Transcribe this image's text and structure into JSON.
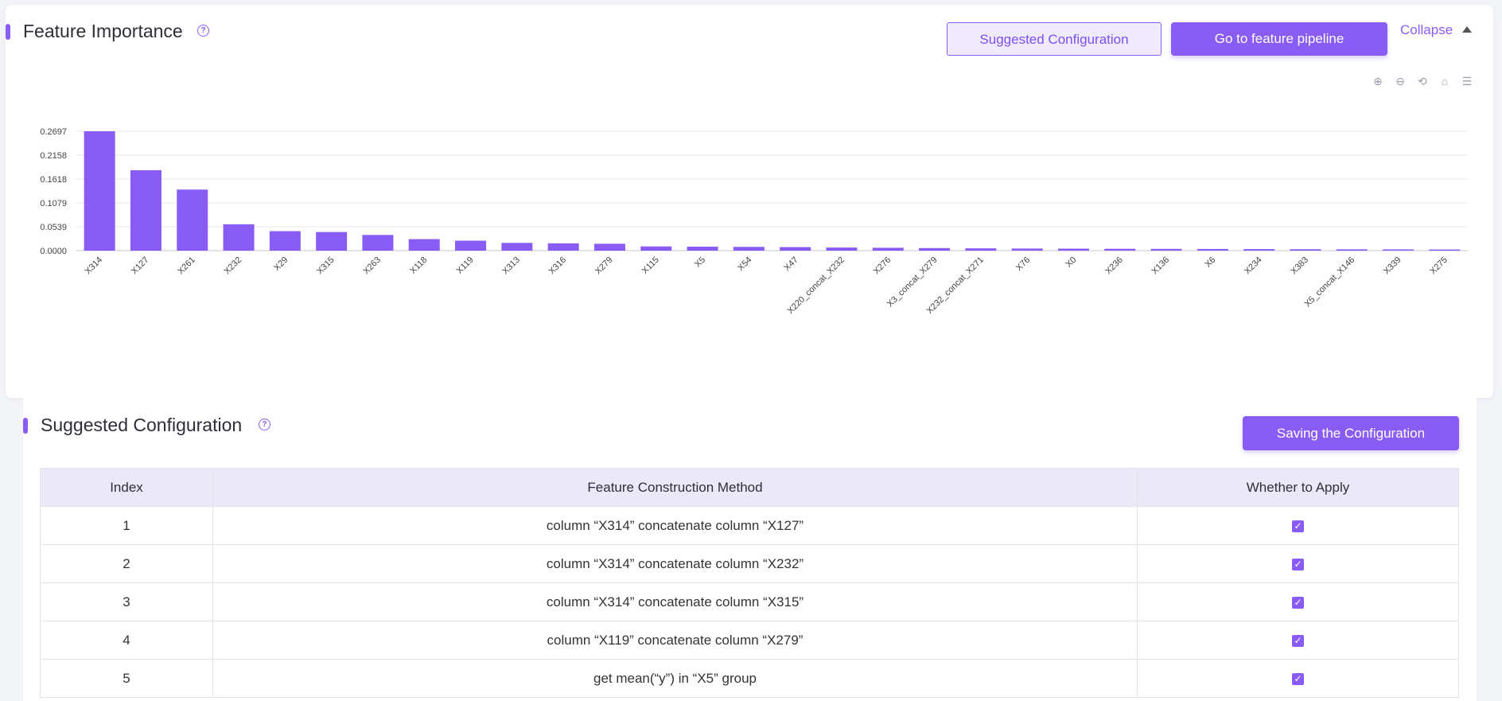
{
  "feature_importance": {
    "title": "Feature Importance",
    "help_icon": "question-circle-icon",
    "suggested_config_button": "Suggested Configuration",
    "pipeline_button": "Go to feature pipeline",
    "collapse_label": "Collapse",
    "toolbox_icons": [
      "zoom-in-icon",
      "zoom-out-icon",
      "restore-icon",
      "home-icon",
      "menu-icon"
    ]
  },
  "chart_data": {
    "type": "bar",
    "categories": [
      "X314",
      "X127",
      "X261",
      "X232",
      "X29",
      "X315",
      "X263",
      "X118",
      "X119",
      "X313",
      "X316",
      "X279",
      "X115",
      "X5",
      "X54",
      "X47",
      "X220_concat_X232",
      "X276",
      "X3_concat_X279",
      "X232_concat_X271",
      "X76",
      "X0",
      "X236",
      "X136",
      "X6",
      "X234",
      "X383",
      "X5_concat_X146",
      "X339",
      "X275"
    ],
    "values": [
      0.2697,
      0.1818,
      0.138,
      0.0595,
      0.044,
      0.042,
      0.0355,
      0.026,
      0.0225,
      0.0175,
      0.0165,
      0.0155,
      0.0095,
      0.009,
      0.0085,
      0.008,
      0.007,
      0.0065,
      0.0058,
      0.0052,
      0.0048,
      0.0045,
      0.0042,
      0.004,
      0.0038,
      0.0035,
      0.0032,
      0.003,
      0.0028,
      0.0026
    ],
    "y_ticks": [
      "0.0000",
      "0.0539",
      "0.1079",
      "0.1618",
      "0.2158",
      "0.2697"
    ],
    "ylim": [
      0,
      0.2697
    ],
    "grid": true,
    "color": "#8a5cf6"
  },
  "suggested_configuration": {
    "title": "Suggested Configuration",
    "save_button": "Saving the Configuration",
    "columns": [
      "Index",
      "Feature Construction Method",
      "Whether to Apply"
    ],
    "rows": [
      {
        "index": "1",
        "method": "column “X314” concatenate column “X127”",
        "apply": true
      },
      {
        "index": "2",
        "method": "column “X314” concatenate column “X232”",
        "apply": true
      },
      {
        "index": "3",
        "method": "column “X314” concatenate column “X315”",
        "apply": true
      },
      {
        "index": "4",
        "method": "column “X119” concatenate column “X279”",
        "apply": true
      },
      {
        "index": "5",
        "method": "get mean(“y”) in “X5” group",
        "apply": true
      }
    ]
  },
  "colors": {
    "accent": "#8a5cf6",
    "header_bg": "#ebe8f8"
  }
}
